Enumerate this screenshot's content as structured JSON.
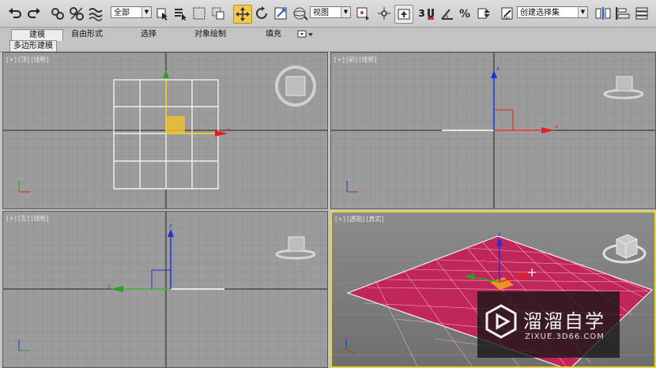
{
  "toolbar": {
    "selection_filter": "全部",
    "reference_coord": "视图",
    "snap_label": "3",
    "named_selection_placeholder": "创建选择集"
  },
  "ribbon": {
    "tabs": [
      "建模",
      "自由形式",
      "选择",
      "对象绘制",
      "填充"
    ],
    "active_tab": "建模",
    "sub_tab": "多边形建模"
  },
  "viewports": {
    "top": {
      "plus": "[+]",
      "name": "[顶]",
      "mode": "[线框]"
    },
    "front": {
      "plus": "[+]",
      "name": "[前]",
      "mode": "[线框]"
    },
    "left": {
      "plus": "[+]",
      "name": "[左]",
      "mode": "[线框]"
    },
    "perspective": {
      "plus": "[+]",
      "name": "[透视]",
      "mode": "[真实]"
    }
  },
  "watermark": {
    "title": "溜溜自学",
    "url": "ZIXUE.3D66.COM"
  },
  "colors": {
    "active_border": "#e8d53a",
    "plane": "#c0265a",
    "axis_x": "#e52020",
    "axis_y": "#2aa02a",
    "axis_z": "#2030d8",
    "selected": "#f0c030"
  }
}
